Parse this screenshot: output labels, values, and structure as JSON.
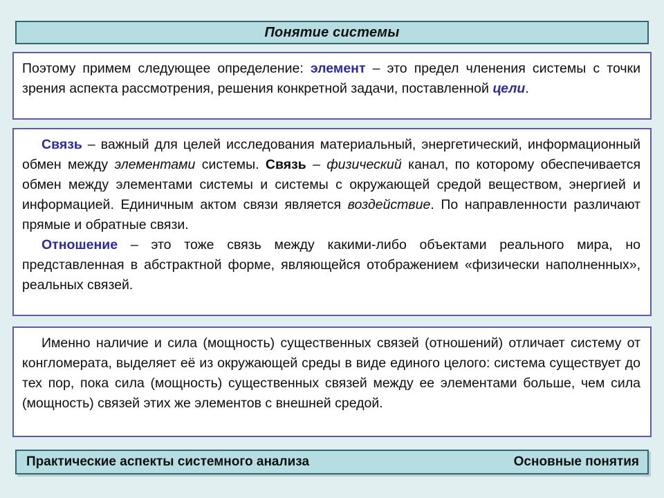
{
  "slide": {
    "title": "Понятие системы",
    "background_color": "#e2eff1",
    "accent_color": "#2b2b9c",
    "bar_color": "#b6dde2",
    "bar_border_color": "#2f6670",
    "box_border_color": "#5a5aa6"
  },
  "blocks": [
    {
      "id": "definition-element",
      "paragraphs": [
        {
          "runs": [
            {
              "text": "Поэтому примем следующее определение:  ",
              "style": "normal"
            },
            {
              "text": "элемент",
              "style": "bold-blue"
            },
            {
              "text": " – это предел членения системы с точки зрения аспекта рассмотрения, решения конкретной задачи, поставленной ",
              "style": "normal"
            },
            {
              "text": "цели",
              "style": "bold-italic-blue"
            },
            {
              "text": ".",
              "style": "normal"
            }
          ]
        }
      ]
    },
    {
      "id": "definition-link-relation",
      "paragraphs": [
        {
          "runs": [
            {
              "text": "Связь",
              "style": "bold-blue"
            },
            {
              "text": " – важный для целей исследования материальный, энергетический, информационный обмен между ",
              "style": "normal"
            },
            {
              "text": "элементами",
              "style": "italic"
            },
            {
              "text": " системы. ",
              "style": "normal"
            },
            {
              "text": "Связь",
              "style": "bold-black"
            },
            {
              "text": " – ",
              "style": "normal"
            },
            {
              "text": "физический",
              "style": "italic"
            },
            {
              "text": " канал, по которому обеспечивается обмен между элементами системы и системы с окружающей средой веществом, энергией и информацией. Единичным актом связи является ",
              "style": "normal"
            },
            {
              "text": "воздействие",
              "style": "italic"
            },
            {
              "text": ".  По направленности различают прямые и обратные связи.",
              "style": "normal"
            }
          ]
        },
        {
          "runs": [
            {
              "text": "Отношение",
              "style": "bold-blue"
            },
            {
              "text": " – это тоже связь между какими-либо объектами реального мира, но представленная в абстрактной форме, являющейся отображением «физически наполненных», реальных связей.",
              "style": "normal"
            }
          ]
        }
      ]
    },
    {
      "id": "system-vs-conglomerate",
      "paragraphs": [
        {
          "runs": [
            {
              "text": "Именно наличие и сила (мощность) существенных связей (отношений) отличает систему от конгломерата, выделяет её из окружающей среды в виде единого целого: система существует до тех пор, пока сила (мощность) существенных связей между ее элементами больше, чем сила (мощность) связей этих же элементов с внешней средой.",
              "style": "normal"
            }
          ]
        }
      ]
    }
  ],
  "footer": {
    "left_label": "Практические аспекты системного анализа",
    "right_label": "Основные понятия"
  }
}
